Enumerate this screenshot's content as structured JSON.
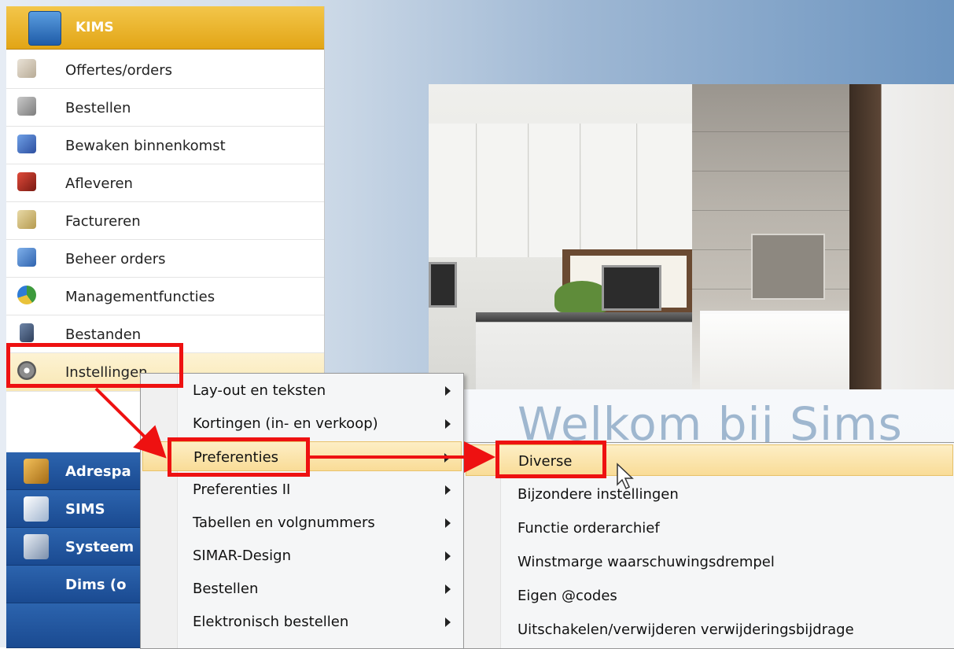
{
  "nav": {
    "header": {
      "label": "KIMS"
    },
    "items": [
      {
        "label": "Offertes/orders",
        "icon": "hand-document-icon"
      },
      {
        "label": "Bestellen",
        "icon": "cash-register-icon"
      },
      {
        "label": "Bewaken binnenkomst",
        "icon": "monitor-user-icon"
      },
      {
        "label": "Afleveren",
        "icon": "truck-icon"
      },
      {
        "label": "Factureren",
        "icon": "invoice-icon"
      },
      {
        "label": "Beheer orders",
        "icon": "folder-icon"
      },
      {
        "label": "Managementfuncties",
        "icon": "pie-chart-icon"
      },
      {
        "label": "Bestanden",
        "icon": "cabinet-icon"
      },
      {
        "label": "Instellingen",
        "icon": "gears-icon"
      }
    ],
    "groups": [
      {
        "label": "Adrespa",
        "icon": "address-book-icon"
      },
      {
        "label": "SIMS",
        "icon": "faucet-icon"
      },
      {
        "label": "Systeem",
        "icon": "system-gear-icon"
      },
      {
        "label": "Dims (o",
        "icon": ""
      }
    ]
  },
  "menu1": {
    "items": [
      {
        "label": "Lay-out en teksten"
      },
      {
        "label": "Kortingen (in- en verkoop)"
      },
      {
        "label": "Preferenties"
      },
      {
        "label": "Preferenties II"
      },
      {
        "label": "Tabellen en volgnummers"
      },
      {
        "label": "SIMAR-Design"
      },
      {
        "label": "Bestellen"
      },
      {
        "label": "Elektronisch bestellen"
      }
    ]
  },
  "menu2": {
    "items": [
      {
        "label": "Diverse"
      },
      {
        "label": "Bijzondere instellingen"
      },
      {
        "label": "Functie orderarchief"
      },
      {
        "label": "Winstmarge waarschuwingsdrempel"
      },
      {
        "label": "Eigen @codes"
      },
      {
        "label": "Uitschakelen/verwijderen verwijderingsbijdrage"
      }
    ]
  },
  "welcome": {
    "text": "Welkom bij Sims"
  },
  "colors": {
    "accent": "#e2a516",
    "nav_group": "#1a4a91",
    "highlight": "#f9dc97",
    "annotation": "#ee1111"
  }
}
